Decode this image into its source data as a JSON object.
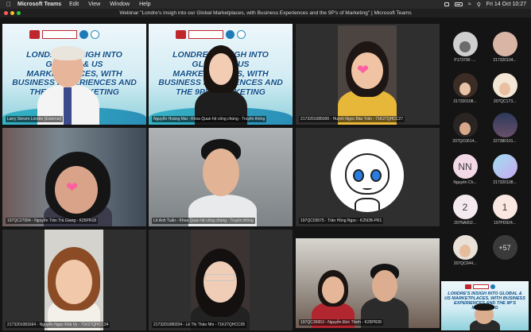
{
  "menubar": {
    "apple_icon": "apple-icon",
    "app_name": "Microsoft Teams",
    "items": [
      "Edit",
      "View",
      "Window",
      "Help"
    ],
    "clock": "Fri 14 Oct  10:27"
  },
  "window": {
    "title": "Webinar \"Londre's insigh into our Global Marketplaces, with Business Experiences and the 9P's of Marketing\" | Microsoft Teams"
  },
  "slide": {
    "logo_text": "VLU",
    "headline": "LONDRE'S INSIGH INTO GLOBAL & US MARKETPLACES, WITH BUSINESS EXPERIENCES AND THE 9P'S MARKETING"
  },
  "tiles": [
    {
      "name": "Larry Steven Londre (External)"
    },
    {
      "name": "Nguyễn Hoàng Mai - Khoa Quan hệ công chúng - Truyền thông"
    },
    {
      "name": "2173201085000 - Huỳnh Ngọc Bảo Trân - 71K27QHCC27"
    },
    {
      "name": "197QC27084 - Nguyễn Trần Trà Giang - K25PR18"
    },
    {
      "name": "Lê Anh Tuấn - Khoa Quan hệ công chúng - Truyền thông"
    },
    {
      "name": "197QC03575 - Trần Hồng Ngọc - K25DB-PR1"
    },
    {
      "name": "2173201081664 - Nguyễn Ngọc Khả Vy - 71K27QHCC34"
    },
    {
      "name": "2173201080204 - Lê Thị Thảo Nhi - 71K27QHCC05"
    },
    {
      "name": "197QC35953 - Nguyễn Đức Thịnh - K25PR28"
    }
  ],
  "roster": [
    {
      "label": "P173790 -...",
      "initials": ""
    },
    {
      "label": "217320104...",
      "initials": ""
    },
    {
      "label": "217320108...",
      "initials": ""
    },
    {
      "label": "207QC173...",
      "initials": ""
    },
    {
      "label": "207QC0614...",
      "initials": ""
    },
    {
      "label": "227380101...",
      "initials": ""
    },
    {
      "label": "Nguyễn Ch...",
      "initials": "NN"
    },
    {
      "label": "217320108...",
      "initials": ""
    },
    {
      "label": "207NA002...",
      "initials": "2"
    },
    {
      "label": "197PD924...",
      "initials": "1"
    },
    {
      "label": "207QC044...",
      "initials": ""
    },
    {
      "label": "",
      "initials": "+57"
    }
  ]
}
